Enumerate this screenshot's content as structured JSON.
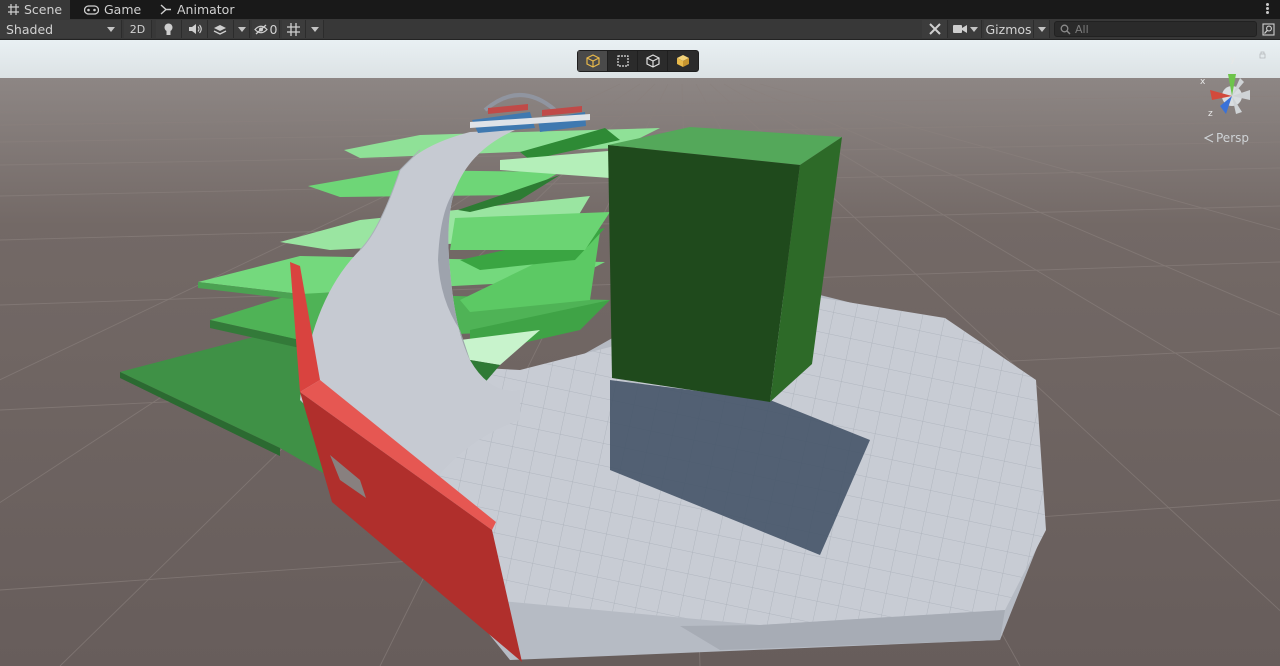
{
  "tabs": [
    {
      "label": "Scene",
      "icon": "grid-icon",
      "active": true
    },
    {
      "label": "Game",
      "icon": "gamepad-icon",
      "active": false
    },
    {
      "label": "Animator",
      "icon": "animator-icon",
      "active": false
    }
  ],
  "toolbar": {
    "draw_mode": "Shaded",
    "mode_2d": "2D",
    "hidden_count": "0",
    "gizmos_label": "Gizmos",
    "search_placeholder": "All"
  },
  "overlay_tools": [
    {
      "icon": "cube-outline-icon",
      "active": true
    },
    {
      "icon": "rect-select-icon",
      "active": false
    },
    {
      "icon": "cube-wire-icon",
      "active": false
    },
    {
      "icon": "cube-solid-icon",
      "active": false
    }
  ],
  "gizmo": {
    "x_label": "x",
    "y_label": "y",
    "z_label": "z",
    "projection": "Persp"
  },
  "colors": {
    "sky": "#e9f0f3",
    "ground": "#6d6361",
    "platform": "#c8ccd4",
    "green_block": "#2a5a27",
    "green_plank": "#6dd679",
    "red_wall": "#d43d3a",
    "ui_dark": "#383838"
  }
}
